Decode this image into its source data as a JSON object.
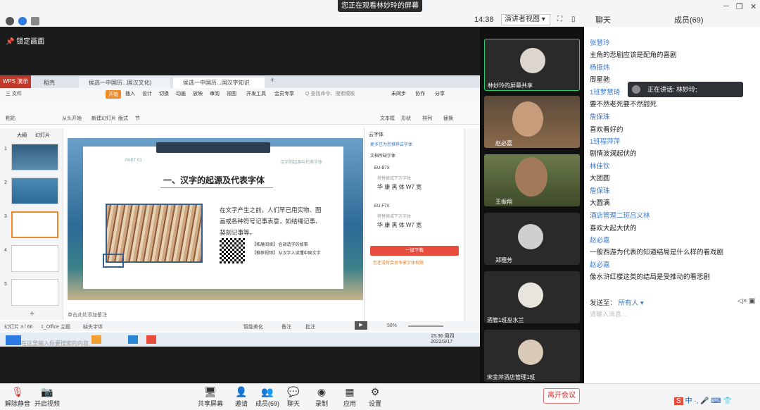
{
  "topbar": {
    "sharing_banner": "您正在观看林妙玲的屏幕",
    "time": "14:38",
    "view_mode": "演讲者视图",
    "tab_chat": "聊天",
    "tab_members": "成员(69)"
  },
  "share": {
    "lock_label": "锁定画面"
  },
  "wps": {
    "logo": "WPS 演示",
    "tabs": [
      "稻壳",
      "侯选一中国历...国汉文化)",
      "侯选一中国历...国汉字知识"
    ],
    "menu": [
      "三 文件",
      "开始",
      "插入",
      "设计",
      "切换",
      "动画",
      "放映",
      "审阅",
      "视图",
      "开发工具",
      "会员专享"
    ],
    "search_placeholder": "Q 查找命令、搜索模板",
    "cloud": [
      "未同步",
      "协作",
      "分享"
    ],
    "ribbon": [
      "粘贴",
      "从头开始",
      "新建幻灯片",
      "版式",
      "节",
      "文本框",
      "形状",
      "排列",
      "替换"
    ],
    "slide_tabs": [
      "大纲",
      "幻灯片"
    ],
    "thumb_numbers": [
      "1",
      "2",
      "3",
      "4",
      "5"
    ],
    "notes": "单击此处添加备注",
    "status": {
      "slide_count": "幻灯片 3 / 66",
      "theme": "1_Office 主题",
      "font_missing": "缺失字体",
      "beautify": "智能美化",
      "notes": "备注",
      "comment": "批注",
      "zoom": "58%"
    }
  },
  "slide": {
    "pill": "PART 01",
    "heading_hint": "汉字的起源与代表字体",
    "title": "一、汉字的起源及代表字体",
    "body": "在文字产生之前，人们早已用实物、图画或各种符号记事表意，如结绳记事、契刻记事等。",
    "qr_line1": "【拓展阅读】 仓颉造字的故事",
    "qr_line2": "【推荐视频】 从汉字入读懂中国文字"
  },
  "right_panel": {
    "title": "云字体",
    "subtitle": "更多已为您推荐云字体",
    "section": "文档所缺字体",
    "font1": "EU-B7X",
    "font1_sub": "将替换成下方字体",
    "font1_chars": "华 康 黑 体 W7 宽",
    "font2": "EU-F7X",
    "font2_sub": "将替换成下方字体",
    "font2_chars": "华 康 黑 体 W7 宽",
    "download": "一键下载",
    "note": "您还没有会员专享字体权限"
  },
  "taskbar": {
    "search": "在这里输入你要搜索的内容",
    "clock_time": "15:36 周四",
    "clock_date": "2022/3/17"
  },
  "videos": [
    {
      "name": "林妙玲的屏幕共享"
    },
    {
      "name": "赵必嘉"
    },
    {
      "name": "王振翔"
    },
    {
      "name": "郑穗芳"
    },
    {
      "name": "酒管1班巫水兰"
    },
    {
      "name": "宋金萍酒店管理1班"
    }
  ],
  "chat": {
    "messages": [
      {
        "sender": "张慧玲",
        "text": "主角的悲剧应该是配角的喜剧"
      },
      {
        "sender": "杨振炜",
        "text": "周星驰"
      },
      {
        "sender": "1班罗慧琦",
        "text": "要不然老死要不然甜死"
      },
      {
        "sender": "詹保珠",
        "text": "喜欢看好的"
      },
      {
        "sender": "1班程萍萍",
        "text": "剧情波澜起伏的"
      },
      {
        "sender": "林佳钦",
        "text": "大团圆"
      },
      {
        "sender": "詹保珠",
        "text": "大圆满"
      },
      {
        "sender": "酒店管理二班吕义林",
        "text": "喜欢大起大伏的"
      },
      {
        "sender": "赵必嘉",
        "text": "一般西游为代表的知道结局是什么样的看戏剧"
      },
      {
        "sender": "赵必嘉",
        "text": "像水浒红楼这类的结局是受推动的看悲剧"
      }
    ],
    "speaking": "正在讲话: 林妙玲;",
    "send_to_label": "发送至：",
    "send_to_value": "所有人",
    "input_placeholder": "请输入消息..."
  },
  "bottombar": {
    "mute": "解除静音",
    "video": "开启视频",
    "share": "共享屏幕",
    "invite": "邀请",
    "members": "成员(69)",
    "chat": "聊天",
    "record": "录制",
    "apps": "应用",
    "settings": "设置",
    "leave": "离开会议"
  },
  "colors": {
    "accent_blue": "#3a78c9",
    "leave_red": "#d32f2f",
    "wps_orange": "#f08a24"
  }
}
